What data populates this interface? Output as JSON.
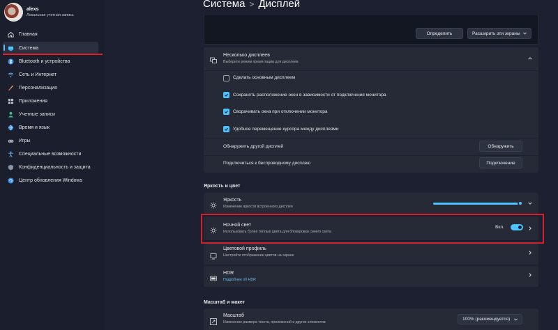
{
  "profile": {
    "name": "alexs",
    "subtitle": "Локальная учетная запись"
  },
  "sidebar": {
    "items": [
      {
        "label": "Главная",
        "icon": "home-icon"
      },
      {
        "label": "Система",
        "icon": "system-icon",
        "active": true
      },
      {
        "label": "Bluetooth и устройства",
        "icon": "bluetooth-icon"
      },
      {
        "label": "Сеть и Интернет",
        "icon": "wifi-icon"
      },
      {
        "label": "Персонализация",
        "icon": "brush-icon"
      },
      {
        "label": "Приложения",
        "icon": "apps-icon"
      },
      {
        "label": "Учетные записи",
        "icon": "person-icon"
      },
      {
        "label": "Время и язык",
        "icon": "globe-icon"
      },
      {
        "label": "Игры",
        "icon": "gamepad-icon"
      },
      {
        "label": "Специальные возможности",
        "icon": "accessibility-icon"
      },
      {
        "label": "Конфиденциальность и защита",
        "icon": "shield-icon"
      },
      {
        "label": "Центр обновления Windows",
        "icon": "update-icon"
      }
    ]
  },
  "header": {
    "section": "Система",
    "page": "Дисплей"
  },
  "preview": {
    "identify_label": "Определить",
    "extend_label": "Расширить эти экраны"
  },
  "multi_display": {
    "title": "Несколько дисплеев",
    "subtitle": "Выберите режим презентации для дисплеев",
    "options": [
      {
        "label": "Сделать основным дисплеем",
        "checked": false
      },
      {
        "label": "Сохранять расположение окон в зависимости от подключения монитора",
        "checked": true
      },
      {
        "label": "Сворачивать окна при отключении монитора",
        "checked": true
      },
      {
        "label": "Удобное перемещение курсора между дисплеями",
        "checked": true
      }
    ],
    "detect_label": "Обнаружить другой дисплей",
    "detect_button": "Обнаружить",
    "wireless_label": "Подключиться к беспроводному дисплею",
    "wireless_button": "Подключение"
  },
  "brightness_section": {
    "heading": "Яркость и цвет",
    "brightness": {
      "title": "Яркость",
      "subtitle": "Изменение яркости встроенного дисплея",
      "level": 1.0
    },
    "night_light": {
      "title": "Ночной свет",
      "subtitle": "Использовать более теплые цвета для блокировки синего света",
      "state_label": "Вкл.",
      "on": true
    },
    "color_profile": {
      "title": "Цветовой профиль",
      "subtitle": "Настройте отображение цветов на экране"
    },
    "hdr": {
      "title": "HDR",
      "link": "Подробнее об HDR"
    }
  },
  "scale_section": {
    "heading": "Масштаб и макет",
    "scale": {
      "title": "Масштаб",
      "subtitle": "Изменение размера текста, приложений и других элементов",
      "value": "100% (рекомендуется)"
    }
  },
  "colors": {
    "accent": "#4cc2ff",
    "highlight_red": "#d61f2a"
  }
}
